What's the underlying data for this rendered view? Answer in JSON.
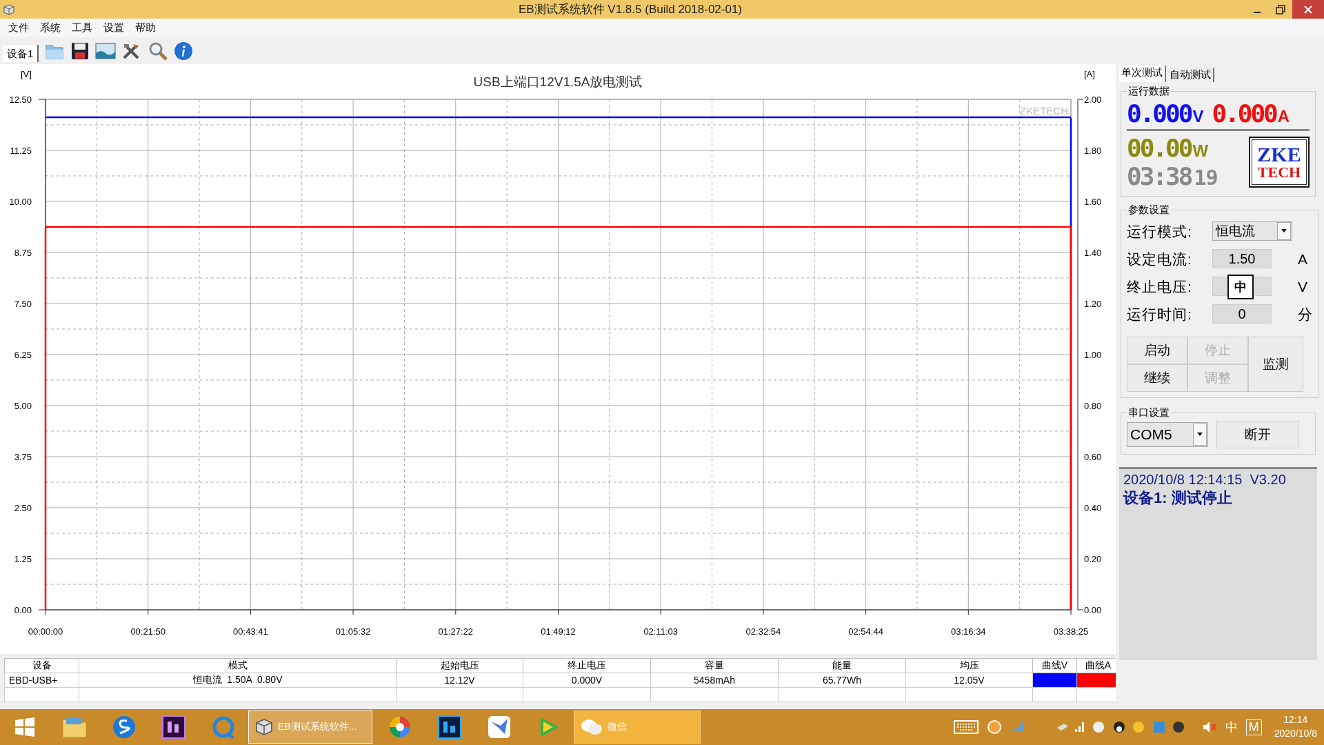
{
  "window": {
    "title": "EB测试系统软件 V1.8.5 (Build 2018-02-01)"
  },
  "menu": [
    "文件",
    "系统",
    "工具",
    "设置",
    "帮助"
  ],
  "toolbar": {
    "device_tab": "设备1"
  },
  "chart": {
    "chart_data": {
      "type": "line",
      "title": "USB上端口12V1.5A放电测试",
      "ylabel": "[V]",
      "y2label": "[A]",
      "categories": [
        "00:00:00",
        "00:21:50",
        "00:43:41",
        "01:05:32",
        "01:27:22",
        "01:49:12",
        "02:11:03",
        "02:32:54",
        "02:54:44",
        "03:16:34",
        "03:38:25"
      ],
      "grid": true,
      "series": [
        {
          "color": "#0000ff",
          "values": [
            12.06,
            12.06,
            12.06,
            12.06,
            12.06,
            12.06,
            12.06,
            12.06,
            12.06,
            12.06,
            12.06
          ]
        },
        {
          "axis": "y2",
          "color": "#ff0000",
          "values": [
            1.5,
            1.5,
            1.5,
            1.5,
            1.5,
            1.5,
            1.5,
            1.5,
            1.5,
            1.5,
            1.5
          ]
        }
      ],
      "ylim": [
        0,
        12.5
      ],
      "yticks": [
        {
          "value": 0,
          "label": "0.00"
        },
        {
          "value": 1.25,
          "label": "1.25"
        },
        {
          "value": 2.5,
          "label": "2.50"
        },
        {
          "value": 3.75,
          "label": "3.75"
        },
        {
          "value": 5,
          "label": "5.00"
        },
        {
          "value": 6.25,
          "label": "6.25"
        },
        {
          "value": 7.5,
          "label": "7.50"
        },
        {
          "value": 8.75,
          "label": "8.75"
        },
        {
          "value": 10,
          "label": "10.00"
        },
        {
          "value": 11.25,
          "label": "11.25"
        },
        {
          "value": 12.5,
          "label": "12.50"
        }
      ],
      "y2lim": [
        0,
        2
      ],
      "y2ticks": [
        {
          "value": 0,
          "label": "0.00"
        },
        {
          "value": 0.2,
          "label": "0.20"
        },
        {
          "value": 0.4,
          "label": "0.40"
        },
        {
          "value": 0.6,
          "label": "0.60"
        },
        {
          "value": 0.8,
          "label": "0.80"
        },
        {
          "value": 1,
          "label": "1.00"
        },
        {
          "value": 1.2,
          "label": "1.20"
        },
        {
          "value": 1.4,
          "label": "1.40"
        },
        {
          "value": 1.6,
          "label": "1.60"
        },
        {
          "value": 1.8,
          "label": "1.80"
        },
        {
          "value": 2,
          "label": "2.00"
        }
      ],
      "annotations": [
        {
          "text": "ZKETECH"
        }
      ]
    }
  },
  "table": {
    "columns": [
      "设备",
      "模式",
      "起始电压",
      "终止电压",
      "容量",
      "能量",
      "均压",
      "曲线V",
      "曲线A"
    ],
    "rows": [
      {
        "cells": [
          "EBD-USB+",
          "恒电流  1.50A  0.80V",
          "12.12V",
          "0.000V",
          "5458mAh",
          "65.77Wh",
          "12.05V"
        ],
        "curves": [
          {
            "color": "#0000ff"
          },
          {
            "color": "#ff0000"
          }
        ]
      }
    ]
  },
  "side_panel": {
    "tabs": [
      {
        "label": "单次测试",
        "selected": true
      },
      {
        "label": "自动测试",
        "selected": false
      }
    ],
    "run_data": {
      "title": "运行数据",
      "voltage": "0.000",
      "voltage_unit": "V",
      "current": "0.000",
      "current_unit": "A",
      "power": "00.00",
      "power_unit": "W",
      "time": "03:38",
      "seconds": "19",
      "logo_top": "ZKE",
      "logo_bottom": "TECH"
    },
    "params": {
      "title": "参数设置",
      "fields": [
        {
          "kind": "dropdown",
          "label": "运行模式:",
          "value": "恒电流"
        },
        {
          "kind": "input",
          "label": "设定电流:",
          "value": "1.50",
          "unit": "A"
        },
        {
          "kind": "ime",
          "label": "终止电压:",
          "ime": "中",
          "unit": "V"
        },
        {
          "kind": "input",
          "label": "运行时间:",
          "value": "0",
          "unit": "分"
        }
      ],
      "buttons": [
        {
          "label": "启动",
          "disabled": false
        },
        {
          "label": "停止",
          "disabled": true
        },
        {
          "label": "继续",
          "disabled": false
        },
        {
          "label": "调整",
          "disabled": true
        },
        {
          "label": "监测",
          "disabled": false
        }
      ]
    },
    "serial": {
      "title": "串口设置",
      "port": "COM5",
      "button": "断开"
    },
    "status": {
      "line1": "2020/10/8 12:14:15  V3.20",
      "line2": "设备1: 测试停止"
    }
  },
  "taskbar": {
    "windows": [
      {
        "label": "EB测试系统软件...",
        "selected": true,
        "flashing": false
      },
      {
        "label": "微信",
        "selected": false,
        "flashing": true
      }
    ],
    "ime": "中",
    "keyboard": "M",
    "time": "12:14",
    "date": "2020/10/8"
  }
}
